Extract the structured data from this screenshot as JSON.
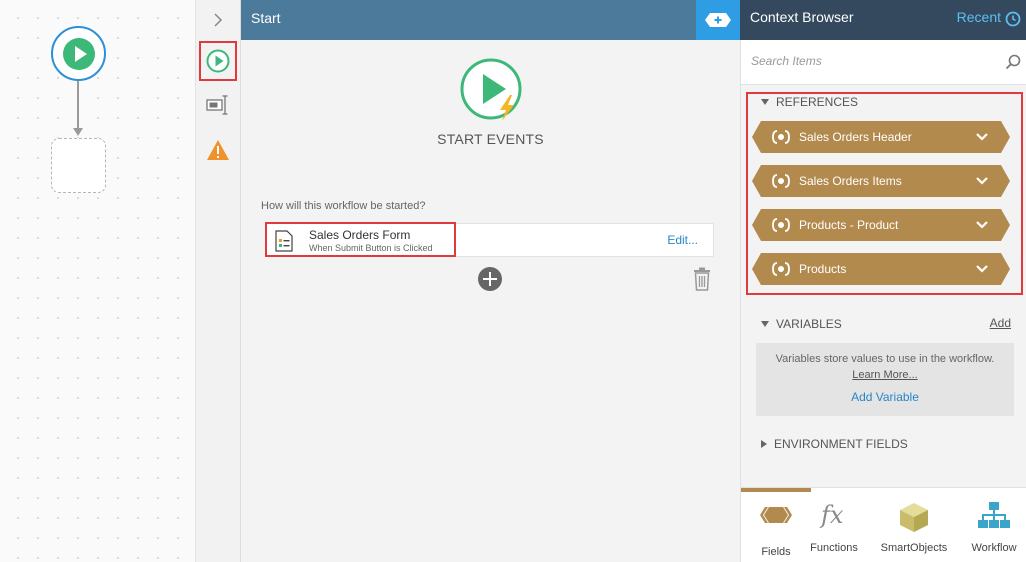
{
  "canvas": {},
  "rail": {
    "items": [
      "expand",
      "start",
      "steps",
      "warnings"
    ]
  },
  "mid": {
    "header_title": "Start",
    "start_events_title": "START EVENTS",
    "question": "How will this workflow be started?",
    "event": {
      "name": "Sales Orders Form",
      "trigger": "When Submit Button is Clicked",
      "edit_label": "Edit..."
    }
  },
  "context_browser": {
    "title": "Context Browser",
    "recent_label": "Recent",
    "search_placeholder": "Search Items",
    "references_label": "REFERENCES",
    "references": [
      {
        "label": "Sales Orders Header"
      },
      {
        "label": "Sales Orders Items"
      },
      {
        "label": "Products - Product"
      },
      {
        "label": "Products"
      }
    ],
    "variables_label": "VARIABLES",
    "variables_add": "Add",
    "variables_desc": "Variables store values to use in the workflow.",
    "variables_learn": "Learn More...",
    "variables_add_variable": "Add Variable",
    "environment_label": "ENVIRONMENT FIELDS",
    "tabs": [
      {
        "label": "Fields"
      },
      {
        "label": "Functions"
      },
      {
        "label": "SmartObjects"
      },
      {
        "label": "Workflow"
      }
    ]
  },
  "colors": {
    "accent_blue": "#2f9de3",
    "header_blue": "#4b7a9a",
    "reference_tan": "#b38a4e",
    "highlight_red": "#e0393e",
    "start_green": "#3cb878"
  }
}
